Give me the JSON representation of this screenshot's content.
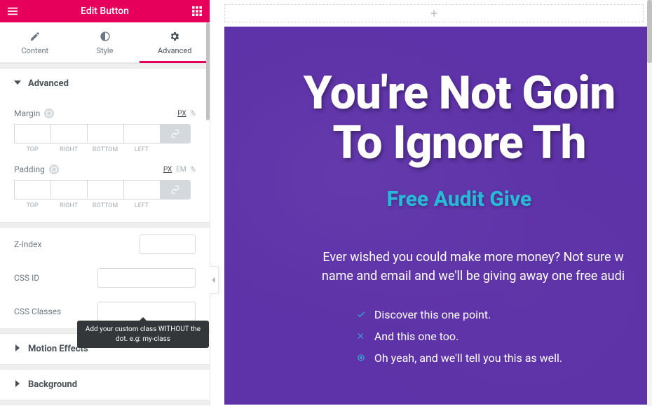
{
  "panel": {
    "title": "Edit Button",
    "tabs": [
      {
        "label": "Content",
        "icon": "pencil-icon"
      },
      {
        "label": "Style",
        "icon": "contrast-icon"
      },
      {
        "label": "Advanced",
        "icon": "gear-icon"
      }
    ],
    "active_tab": 2
  },
  "advanced": {
    "section_title": "Advanced",
    "margin": {
      "label": "Margin",
      "units": [
        "PX",
        "%"
      ],
      "active_unit": "PX",
      "top": "",
      "right": "",
      "bottom": "",
      "left": "",
      "labels": {
        "top": "TOP",
        "right": "RIGHT",
        "bottom": "BOTTOM",
        "left": "LEFT"
      }
    },
    "padding": {
      "label": "Padding",
      "units": [
        "PX",
        "EM",
        "%"
      ],
      "active_unit": "PX",
      "top": "",
      "right": "",
      "bottom": "",
      "left": "",
      "labels": {
        "top": "TOP",
        "right": "RIGHT",
        "bottom": "BOTTOM",
        "left": "LEFT"
      }
    },
    "zindex": {
      "label": "Z-Index",
      "value": ""
    },
    "css_id": {
      "label": "CSS ID",
      "value": ""
    },
    "css_classes": {
      "label": "CSS Classes",
      "value": ""
    },
    "tooltip": "Add your custom class WITHOUT the dot. e.g: my-class"
  },
  "sections": {
    "motion": "Motion Effects",
    "background": "Background"
  },
  "preview": {
    "hero_title": "You're Not Goin\nTo Ignore Th",
    "hero_subtitle": "Free Audit Give",
    "hero_paragraph": "Ever wished you could make more money? Not sure w\nname and email and we'll be giving away one free audi",
    "list": [
      {
        "icon": "check-icon",
        "text": "Discover this one point."
      },
      {
        "icon": "times-icon",
        "text": "And this one too."
      },
      {
        "icon": "bullseye-icon",
        "text": "Oh yeah, and we'll tell you this as well."
      }
    ]
  }
}
